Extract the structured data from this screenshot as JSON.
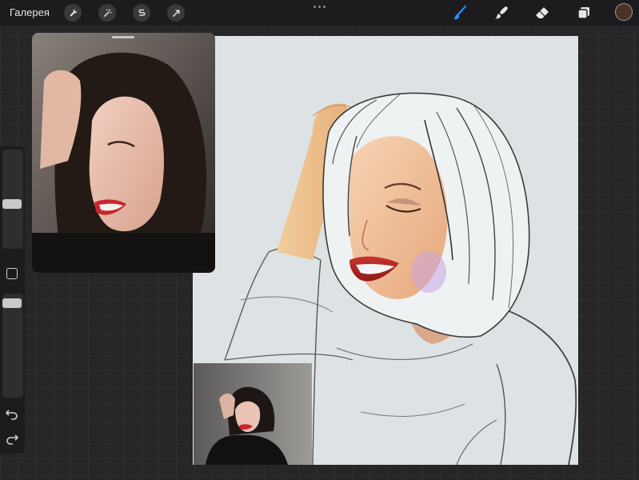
{
  "topbar": {
    "gallery_label": "Галерея",
    "left_tools": [
      "wrench-icon",
      "magic-wand-icon",
      "selection-s-icon",
      "transform-arrow-icon"
    ],
    "right_tools": [
      "brush-icon",
      "smudge-icon",
      "eraser-icon",
      "layers-icon"
    ],
    "active_tool": "brush-icon",
    "active_color": "#4a3326",
    "accent_color": "#2f8cff"
  },
  "sidebar": {
    "brush_size_level": 0.58,
    "opacity_level": 0.1,
    "buttons": [
      "modify-square-icon",
      "undo-icon",
      "redo-icon"
    ]
  },
  "reference_windows": [
    {
      "name": "reference-photo-main",
      "subject": "woman-with-dark-bob-smiling"
    },
    {
      "name": "reference-photo-small",
      "subject": "woman-in-black-sweater-seated"
    }
  ],
  "canvas": {
    "background_color": "#dde3e4"
  }
}
